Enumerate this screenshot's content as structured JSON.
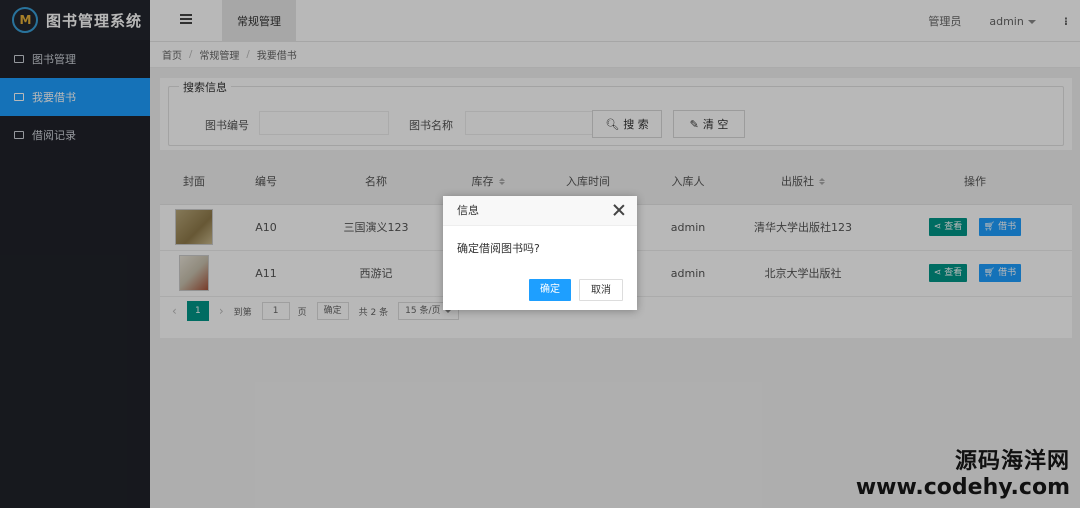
{
  "app": {
    "title": "图书管理系统"
  },
  "sidebar": {
    "items": [
      {
        "label": "图书管理"
      },
      {
        "label": "我要借书"
      },
      {
        "label": "借阅记录"
      }
    ]
  },
  "header": {
    "tab": "常规管理",
    "role": "管理员",
    "user": "admin"
  },
  "breadcrumb": {
    "items": [
      "首页",
      "常规管理",
      "我要借书"
    ]
  },
  "search": {
    "legend": "搜索信息",
    "fields": [
      {
        "label": "图书编号",
        "value": ""
      },
      {
        "label": "图书名称",
        "value": ""
      }
    ],
    "search_btn": "搜 索",
    "clear_btn": "清 空"
  },
  "table": {
    "headers": [
      "封面",
      "编号",
      "名称",
      "库存",
      "入库时间",
      "入库人",
      "出版社",
      "操作"
    ],
    "rows": [
      {
        "code": "A10",
        "name": "三国演义123",
        "stock": "",
        "time": "",
        "operator": "admin",
        "publisher": "清华大学出版社123"
      },
      {
        "code": "A11",
        "name": "西游记",
        "stock": "",
        "time": "",
        "operator": "admin",
        "publisher": "北京大学出版社"
      }
    ],
    "view_btn": "查看",
    "borrow_btn": "借书"
  },
  "pager": {
    "current": "1",
    "goto_label": "到第",
    "goto_value": "1",
    "page_unit": "页",
    "confirm": "确定",
    "total": "共 2 条",
    "size": "15 条/页"
  },
  "dialog": {
    "title": "信息",
    "message": "确定借阅图书吗?",
    "ok": "确定",
    "cancel": "取消"
  },
  "watermark": {
    "cn": "源码海洋网",
    "en": "www.codehy.com"
  },
  "colors": {
    "accent": "#1e9fff",
    "teal": "#009688",
    "sidebar": "#20222a"
  }
}
